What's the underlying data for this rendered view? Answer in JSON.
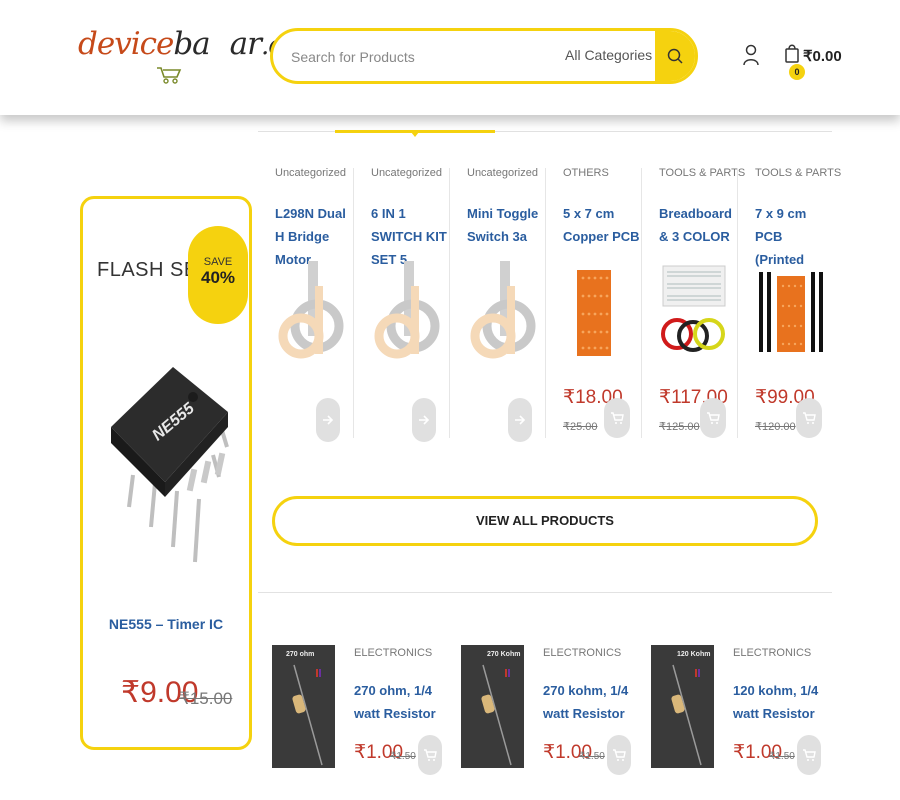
{
  "header": {
    "logo": {
      "part1": "device",
      "part2": "ba",
      "part3": "ar",
      "part4": ".com"
    },
    "search": {
      "placeholder": "Search for Products",
      "category": "All Categories"
    },
    "cart": {
      "count": "0",
      "total": "₹0.00"
    }
  },
  "flash": {
    "title": "FLASH SELL",
    "save_label": "SAVE",
    "save_pct": "40%",
    "chip_label": "NE555",
    "name": "NE555 – Timer IC",
    "price": "₹9.00",
    "old_price": "₹15.00"
  },
  "products": [
    {
      "category": "Uncategorized",
      "name": "L298N Dual H Bridge Motor",
      "price": "",
      "old_price": "",
      "image": "placeholder-logo"
    },
    {
      "category": "Uncategorized",
      "name": "6 IN 1 SWITCH KIT SET 5",
      "price": "",
      "old_price": "",
      "image": "placeholder-logo"
    },
    {
      "category": "Uncategorized",
      "name": "Mini Toggle Switch 3a",
      "price": "",
      "old_price": "",
      "image": "placeholder-logo"
    },
    {
      "category": "OTHERS",
      "name": "5 x 7 cm Copper PCB",
      "price": "₹18.00",
      "old_price": "₹25.00",
      "image": "pcb"
    },
    {
      "category": "TOOLS & PARTS",
      "name": "Breadboard & 3 COLOR",
      "price": "₹117.00",
      "old_price": "₹125.00",
      "image": "breadboard"
    },
    {
      "category": "TOOLS & PARTS",
      "name": "7 x 9 cm PCB (Printed",
      "price": "₹99.00",
      "old_price": "₹120.00",
      "image": "pcb-sticks"
    }
  ],
  "view_all_label": "VIEW ALL PRODUCTS",
  "resistors": [
    {
      "category": "ELECTRONICS",
      "name": "270 ohm, 1/4 watt Resistor",
      "price": "₹1.00",
      "old_price": "₹1.50",
      "img_label": "270 ohm"
    },
    {
      "category": "ELECTRONICS",
      "name": "270 kohm, 1/4 watt Resistor",
      "price": "₹1.00",
      "old_price": "₹1.50",
      "img_label": "270 Kohm"
    },
    {
      "category": "ELECTRONICS",
      "name": "120 kohm, 1/4 watt Resistor",
      "price": "₹1.00",
      "old_price": "₹1.50",
      "img_label": "120 Kohm"
    }
  ],
  "colors": {
    "accent": "#f5d20f",
    "link": "#2a5d9f",
    "price": "#c0392b"
  }
}
